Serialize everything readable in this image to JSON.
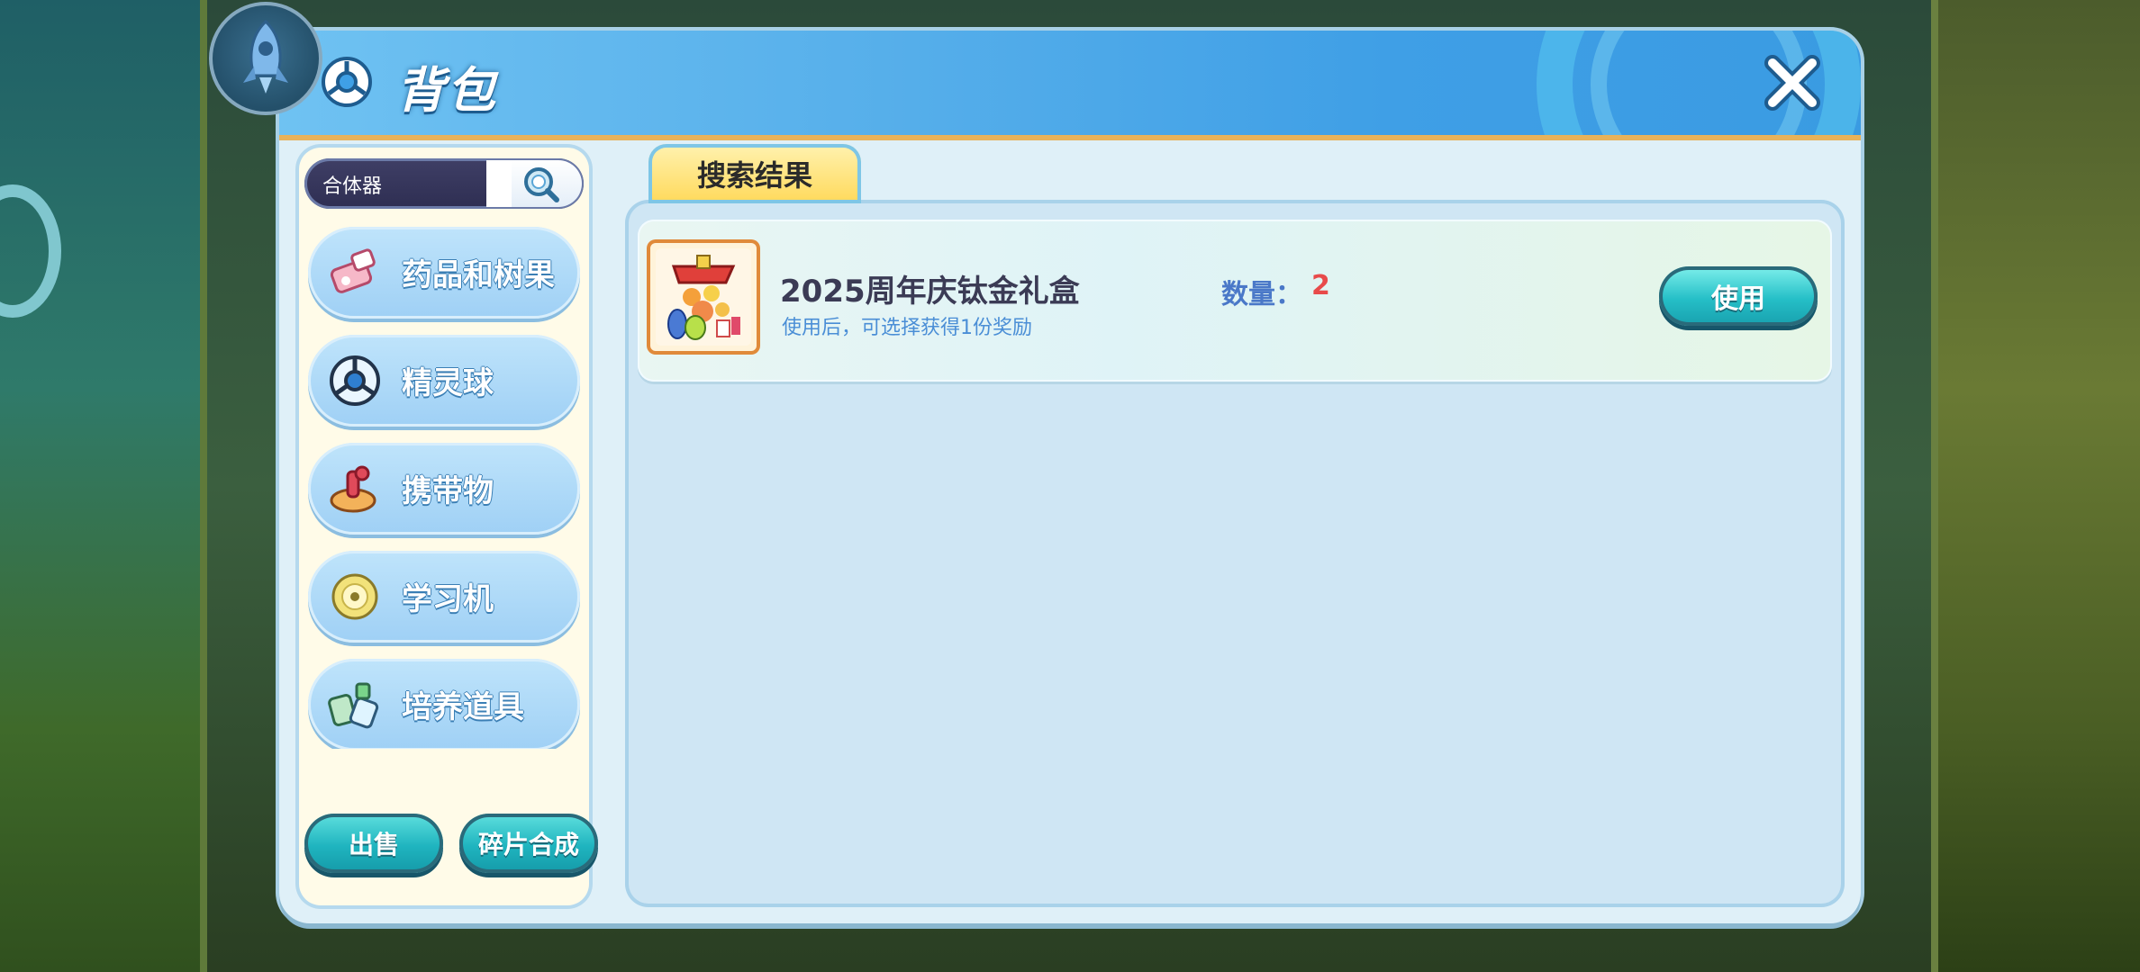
{
  "dialog": {
    "title": "背包",
    "title_icon": "pokeball-icon",
    "close_icon": "close-icon"
  },
  "search": {
    "value": "合体器",
    "icon": "magnifier-icon"
  },
  "categories": [
    {
      "label": "药品和树果",
      "icon": "medicine-spray-icon"
    },
    {
      "label": "精灵球",
      "icon": "pokeball-icon"
    },
    {
      "label": "携带物",
      "icon": "held-item-icon"
    },
    {
      "label": "学习机",
      "icon": "disc-icon"
    },
    {
      "label": "培养道具",
      "icon": "training-items-icon"
    }
  ],
  "bottom_buttons": {
    "sell": "出售",
    "fragment_combine": "碎片合成"
  },
  "tab": {
    "label": "搜索结果"
  },
  "items": [
    {
      "name": "2025周年庆钛金礼盒",
      "description": "使用后，可选择获得1份奖励",
      "qty_label": "数量：",
      "qty_value": "2",
      "use_label": "使用",
      "icon": "gift-box-icon"
    }
  ],
  "colors": {
    "header_blue": "#55aeea",
    "accent_teal": "#1fb4bf",
    "quantity_red": "#e84a4a",
    "tab_yellow": "#ffd95a"
  }
}
